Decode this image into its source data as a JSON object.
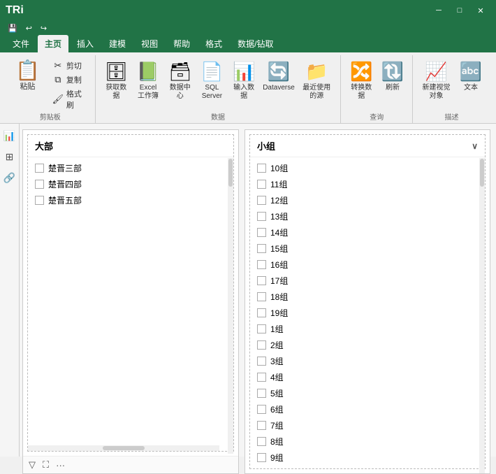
{
  "titlebar": {
    "title": "TRi",
    "minimize_label": "─",
    "restore_label": "□",
    "close_label": "✕"
  },
  "quickaccess": {
    "save": "💾",
    "undo": "↩",
    "redo": "↪"
  },
  "ribbon": {
    "tabs": [
      {
        "id": "file",
        "label": "文件"
      },
      {
        "id": "home",
        "label": "主页",
        "active": true
      },
      {
        "id": "insert",
        "label": "插入"
      },
      {
        "id": "model",
        "label": "建模"
      },
      {
        "id": "view",
        "label": "视图"
      },
      {
        "id": "help",
        "label": "帮助"
      },
      {
        "id": "format",
        "label": "格式"
      },
      {
        "id": "datadrilldown",
        "label": "数据/钻取"
      }
    ],
    "groups": {
      "clipboard": {
        "label": "剪贴板",
        "items": [
          {
            "id": "paste",
            "icon": "📋",
            "label": "粘贴",
            "large": true
          },
          {
            "id": "cut",
            "icon": "✂",
            "label": "剪切"
          },
          {
            "id": "copy",
            "icon": "⧉",
            "label": "复制"
          },
          {
            "id": "format-brush",
            "icon": "🖌",
            "label": "格式刷"
          }
        ]
      },
      "data": {
        "label": "数据",
        "items": [
          {
            "id": "get-data",
            "icon": "🗄",
            "label": "获取数据"
          },
          {
            "id": "excel",
            "icon": "📗",
            "label": "Excel\n工作簿"
          },
          {
            "id": "datacentre",
            "icon": "🗃",
            "label": "数据中心"
          },
          {
            "id": "sql",
            "icon": "📄",
            "label": "SQL\nServer"
          },
          {
            "id": "input-data",
            "icon": "📊",
            "label": "输入数据"
          },
          {
            "id": "dataverse",
            "icon": "🔄",
            "label": "Dataverse"
          },
          {
            "id": "recent",
            "icon": "📁",
            "label": "最近使用的源"
          }
        ]
      },
      "query": {
        "label": "查询",
        "items": [
          {
            "id": "transform",
            "icon": "🔀",
            "label": "转换数据"
          },
          {
            "id": "refresh",
            "icon": "🔃",
            "label": "刷新"
          }
        ]
      },
      "calc": {
        "label": "描述",
        "items": [
          {
            "id": "new-visual",
            "icon": "📈",
            "label": "新建视觉对象"
          },
          {
            "id": "textbox",
            "icon": "🔤",
            "label": "文本"
          }
        ]
      }
    }
  },
  "left_panel": {
    "header": "大部",
    "items": [
      {
        "id": "item1",
        "label": "楚晋三部",
        "checked": false
      },
      {
        "id": "item2",
        "label": "楚晋四部",
        "checked": false
      },
      {
        "id": "item3",
        "label": "楚晋五部",
        "checked": false
      }
    ]
  },
  "right_panel": {
    "header": "小组",
    "items": [
      {
        "id": "g10",
        "label": "10组",
        "checked": false
      },
      {
        "id": "g11",
        "label": "11组",
        "checked": false
      },
      {
        "id": "g12",
        "label": "12组",
        "checked": false
      },
      {
        "id": "g13",
        "label": "13组",
        "checked": false
      },
      {
        "id": "g14",
        "label": "14组",
        "checked": false
      },
      {
        "id": "g15",
        "label": "15组",
        "checked": false
      },
      {
        "id": "g16",
        "label": "16组",
        "checked": false
      },
      {
        "id": "g17",
        "label": "17组",
        "checked": false
      },
      {
        "id": "g18",
        "label": "18组",
        "checked": false
      },
      {
        "id": "g19",
        "label": "19组",
        "checked": false
      },
      {
        "id": "g1",
        "label": "1组",
        "checked": false
      },
      {
        "id": "g2",
        "label": "2组",
        "checked": false
      },
      {
        "id": "g3",
        "label": "3组",
        "checked": false
      },
      {
        "id": "g4",
        "label": "4组",
        "checked": false
      },
      {
        "id": "g5",
        "label": "5组",
        "checked": false
      },
      {
        "id": "g6",
        "label": "6组",
        "checked": false
      },
      {
        "id": "g7",
        "label": "7组",
        "checked": false
      },
      {
        "id": "g8",
        "label": "8组",
        "checked": false
      },
      {
        "id": "g9",
        "label": "9组",
        "checked": false
      }
    ]
  },
  "footer_icons": {
    "filter": "▽",
    "expand": "⛶",
    "more": "···"
  }
}
